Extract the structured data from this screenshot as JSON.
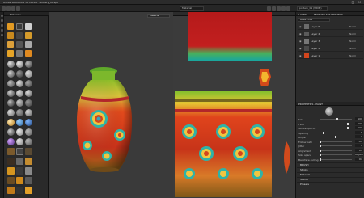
{
  "app": {
    "title": "Adobe Substance 3D Painter - Pottery_01.spp"
  },
  "toolbar": {
    "viewport_mode": "Material",
    "texture_set": "pottery_01 (UDIM)"
  },
  "shelf": {
    "tabs": [
      "Materials"
    ]
  },
  "viewport": {
    "display_mode": "Material"
  },
  "layers_panel": {
    "tabs": [
      "LAYERS",
      "TEXTURE SET SETTINGS"
    ],
    "channel": "Base color",
    "layers": [
      {
        "name": "Layer 5",
        "blend": "Norm",
        "opacity": "100"
      },
      {
        "name": "Layer 4",
        "blend": "Norm",
        "opacity": "100"
      },
      {
        "name": "Layer 3",
        "blend": "Norm",
        "opacity": "100"
      },
      {
        "name": "Layer 2",
        "blend": "Norm",
        "opacity": "100"
      },
      {
        "name": "Layer 1",
        "blend": "Norm",
        "opacity": "100"
      }
    ]
  },
  "properties_panel": {
    "tabs": [
      "PROPERTIES - PAINT"
    ],
    "sections": [
      "BRUSH",
      "Stroke",
      "Material",
      "Stencil",
      "Presets"
    ],
    "params": [
      {
        "label": "Size",
        "value": "100",
        "level": 0.55
      },
      {
        "label": "Flow",
        "value": "100",
        "level": 0.9
      },
      {
        "label": "Stroke opacity",
        "value": "100",
        "level": 0.9
      },
      {
        "label": "Spacing",
        "value": "5",
        "level": 0.1
      },
      {
        "label": "Angle",
        "value": "0",
        "level": 0.5
      },
      {
        "label": "Follow path",
        "value": "Off",
        "level": 0.0
      },
      {
        "label": "Jitter",
        "value": "0",
        "level": 0.0
      },
      {
        "label": "Alignment",
        "value": "UV",
        "level": 0.0
      },
      {
        "label": "Size space",
        "value": "Object",
        "level": 0.0
      },
      {
        "label": "Backface culling",
        "value": "On",
        "level": 0.0
      }
    ]
  },
  "colors": {
    "pot_red": "#d23a1e",
    "pot_green": "#6fb02a",
    "accent_orange": "#e8a228"
  }
}
